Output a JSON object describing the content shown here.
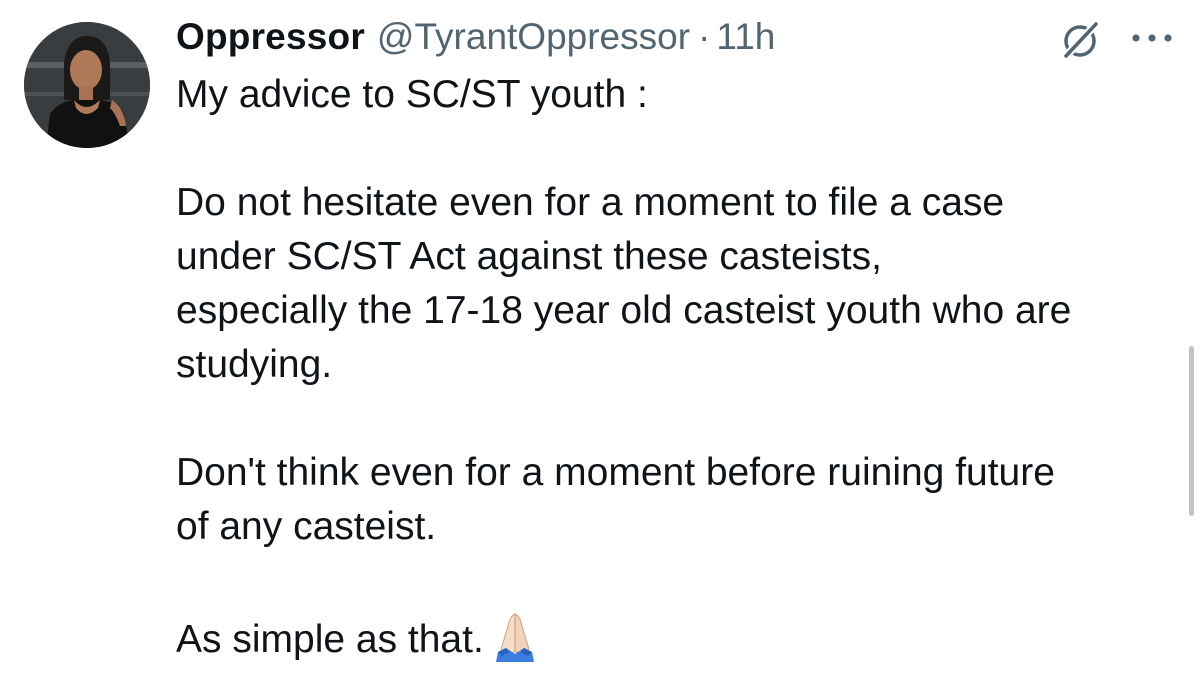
{
  "tweet": {
    "author": {
      "display_name": "Oppressor",
      "handle": "@TyrantOppressor",
      "separator": "·",
      "time": "11h"
    },
    "icons": {
      "avatar": "profile-photo",
      "grok": "grok-icon",
      "more": "more-options-icon",
      "emoji": "folded-hands-emoji"
    },
    "body": {
      "line1": "My advice to SC/ST youth :",
      "para2_line1": "Do not hesitate even for a moment to file a case",
      "para2_line2": "under SC/ST Act against these casteists,",
      "para2_line3": "especially the 17-18 year old casteist youth who are",
      "para2_line4": "studying.",
      "para3_line1": "Don't think even for a moment before ruining future",
      "para3_line2": "of any casteist.",
      "para4_line1": "As simple as that."
    },
    "colors": {
      "text": "#0f1419",
      "secondary": "#536471",
      "background": "#ffffff"
    }
  }
}
